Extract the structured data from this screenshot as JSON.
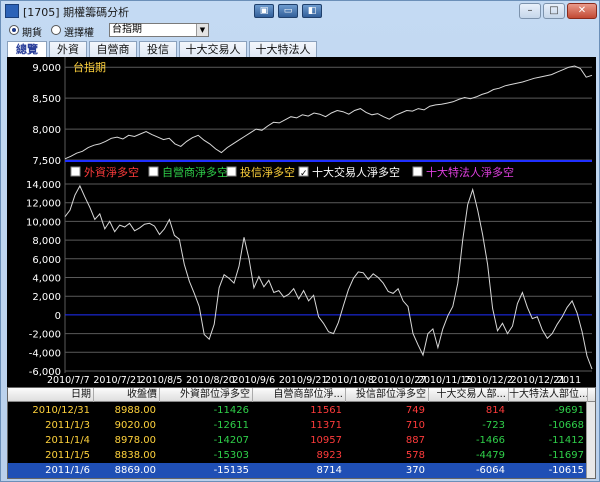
{
  "window": {
    "title": "[1705] 期權籌碼分析",
    "toolbar_buttons": [
      "▣",
      "▭",
      "◧"
    ],
    "minimize": "–",
    "maximize": "□",
    "close": "✕"
  },
  "mode": {
    "options": [
      {
        "label": "期貨",
        "selected": true
      },
      {
        "label": "選擇權",
        "selected": false
      }
    ],
    "select_value": "台指期"
  },
  "tabs": [
    "總覽",
    "外資",
    "自營商",
    "投信",
    "十大交易人",
    "十大特法人"
  ],
  "colors": {
    "positive": "#ff3b3b",
    "negative": "#2fd04a",
    "date_text": "#ffd23c",
    "price_text": "#ffd23c",
    "grid": "#5a5a5a",
    "line": "#d8d8d8",
    "divider": "#1f2fff"
  },
  "chart_data": [
    {
      "type": "line",
      "title": "台指期",
      "ylim": [
        7500,
        9100
      ],
      "yticks": [
        "9,000",
        "8,500",
        "8,000",
        "7,500"
      ],
      "ytick_values": [
        9000,
        8500,
        8000,
        7500
      ],
      "y": [
        7520,
        7560,
        7610,
        7640,
        7700,
        7740,
        7760,
        7800,
        7850,
        7870,
        7840,
        7900,
        7880,
        7920,
        7960,
        7910,
        7870,
        7830,
        7850,
        7760,
        7720,
        7800,
        7860,
        7900,
        7820,
        7760,
        7680,
        7620,
        7700,
        7760,
        7820,
        7880,
        7940,
        8000,
        7980,
        8050,
        8110,
        8100,
        8150,
        8200,
        8180,
        8230,
        8210,
        8260,
        8240,
        8200,
        8260,
        8300,
        8280,
        8240,
        8300,
        8330,
        8270,
        8230,
        8250,
        8200,
        8160,
        8220,
        8260,
        8300,
        8290,
        8330,
        8310,
        8370,
        8390,
        8400,
        8420,
        8440,
        8480,
        8510,
        8490,
        8520,
        8560,
        8590,
        8640,
        8660,
        8700,
        8720,
        8740,
        8760,
        8790,
        8820,
        8840,
        8860,
        8880,
        8920,
        8960,
        9000,
        9020,
        8978,
        8838,
        8869
      ]
    },
    {
      "type": "line",
      "ylim": [
        -6000,
        14000
      ],
      "yticks": [
        "14,000",
        "12,000",
        "10,000",
        "8,000",
        "6,000",
        "4,000",
        "2,000",
        "0",
        "-2,000",
        "-4,000",
        "-6,000"
      ],
      "ytick_values": [
        14000,
        12000,
        10000,
        8000,
        6000,
        4000,
        2000,
        0,
        -2000,
        -4000,
        -6000
      ],
      "legend": [
        {
          "label": "外資淨多空",
          "color": "#ff3b3b",
          "checked": false
        },
        {
          "label": "自營商淨多空",
          "color": "#2fd04a",
          "checked": false
        },
        {
          "label": "投信淨多空",
          "color": "#ffd23c",
          "checked": false
        },
        {
          "label": "十大交易人淨多空",
          "color": "#ffffff",
          "checked": true
        },
        {
          "label": "十大特法人淨多空",
          "color": "#e040e0",
          "checked": false
        }
      ],
      "x": [
        "2010/7/7",
        "2010/7/21",
        "2010/8/5",
        "2010/8/20",
        "2010/9/6",
        "2010/9/21",
        "2010/10/8",
        "2010/10/27",
        "2010/11/15",
        "2010/12/2",
        "2010/12/21",
        "2011"
      ],
      "series": [
        {
          "name": "十大交易人淨多空",
          "values": [
            10500,
            11200,
            12800,
            13800,
            12600,
            11500,
            10200,
            10800,
            9200,
            10000,
            8900,
            9600,
            9400,
            9800,
            9000,
            9300,
            9700,
            9800,
            9500,
            8600,
            9200,
            10200,
            8500,
            8100,
            5400,
            3600,
            2300,
            900,
            -2100,
            -2600,
            -1000,
            2900,
            4300,
            3900,
            3400,
            5200,
            8300,
            6000,
            2900,
            4100,
            3000,
            3700,
            2400,
            2600,
            1900,
            2200,
            2800,
            1700,
            2600,
            1500,
            2100,
            -200,
            -900,
            -1800,
            -2000,
            -800,
            1000,
            2700,
            3900,
            4600,
            4500,
            3800,
            4400,
            4000,
            3400,
            2500,
            2300,
            2800,
            1500,
            900,
            -2000,
            -3200,
            -4300,
            -2000,
            -1500,
            -3500,
            -1500,
            -100,
            900,
            3400,
            8000,
            11800,
            13400,
            11200,
            8600,
            5400,
            700,
            -1700,
            -900,
            -2000,
            -1200,
            1200,
            2400,
            800,
            -400,
            -200,
            -1600,
            -2500,
            -2000,
            -1000,
            -200,
            800,
            1500,
            200,
            -1800,
            -4400,
            -5800
          ]
        }
      ]
    }
  ],
  "table": {
    "headers": [
      "日期",
      "收盤價",
      "外資部位淨多空",
      "自營商部位淨...",
      "投信部位淨多空",
      "十大交易人部...",
      "十大特法人部位..."
    ],
    "rows": [
      {
        "date": "2010/12/31",
        "close": "8988.00",
        "foreign": "-11426",
        "dealer": "11561",
        "trust": "749",
        "top10": "814",
        "top10_special": "-9691"
      },
      {
        "date": "2011/1/3",
        "close": "9020.00",
        "foreign": "-12611",
        "dealer": "11371",
        "trust": "710",
        "top10": "-723",
        "top10_special": "-10668"
      },
      {
        "date": "2011/1/4",
        "close": "8978.00",
        "foreign": "-14207",
        "dealer": "10957",
        "trust": "887",
        "top10": "-1466",
        "top10_special": "-11412"
      },
      {
        "date": "2011/1/5",
        "close": "8838.00",
        "foreign": "-15303",
        "dealer": "8923",
        "trust": "578",
        "top10": "-4479",
        "top10_special": "-11697"
      },
      {
        "date": "2011/1/6",
        "close": "8869.00",
        "foreign": "-15135",
        "dealer": "8714",
        "trust": "370",
        "top10": "-6064",
        "top10_special": "-10615"
      }
    ]
  }
}
